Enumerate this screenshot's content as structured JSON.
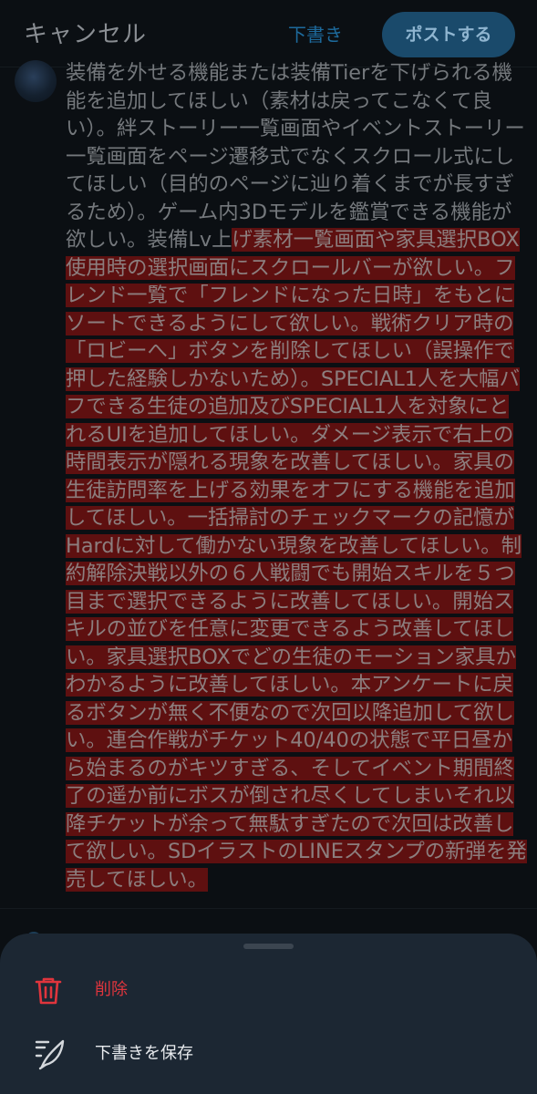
{
  "header": {
    "cancel_label": "キャンセル",
    "draft_label": "下書き",
    "post_label": "ポストする"
  },
  "compose": {
    "text_unselected": "装備を外せる機能または装備Tierを下げられる機能を追加してほしい（素材は戻ってこなくて良い）。絆ストーリー一覧画面やイベントストーリー一覧画面をページ遷移式でなくスクロール式にしてほしい（目的のページに辿り着くまでが長すぎるため）。ゲーム内3Dモデルを鑑賞できる機能が欲しい。装備Lv上",
    "text_selected": "げ素材一覧画面や家具選択BOX使用時の選択画面にスクロールバーが欲しい。フレンド一覧で「フレンドになった日時」をもとにソートできるようにして欲しい。戦術クリア時の「ロビーへ」ボタンを削除してほしい（誤操作で押した経験しかないため）。SPECIAL1人を大幅バフできる生徒の追加及びSPECIAL1人を対象にとれるUIを追加してほしい。ダメージ表示で右上の時間表示が隠れる現象を改善してほしい。家具の生徒訪問率を上げる効果をオフにする機能を追加してほしい。一括掃討のチェックマークの記憶がHardに対して働かない現象を改善してほしい。制約解除決戦以外の６人戦闘でも開始スキルを５つ目まで選択できるように改善してほしい。開始スキルの並びを任意に変更できるよう改善してほしい。家具選択BOXでどの生徒のモーション家具かわかるように改善してほしい。本アンケートに戻るボタンが無く不便なので次回以降追加して欲しい。連合作戦がチケット40/40の状態で平日昼から始まるのがキツすぎる、そしてイベント期間終了の遥か前にボスが倒され尽くしてしまいそれ以降チケットが余って無駄すぎたので次回は改善して欲しい。SDイラストのLINEスタンプの新弾を発売してほしい。"
  },
  "sheet": {
    "delete_label": "削除",
    "save_draft_label": "下書きを保存",
    "delete_color": "#e0353d"
  },
  "icons": {
    "delete": "trash-icon",
    "save": "feather-icon"
  }
}
